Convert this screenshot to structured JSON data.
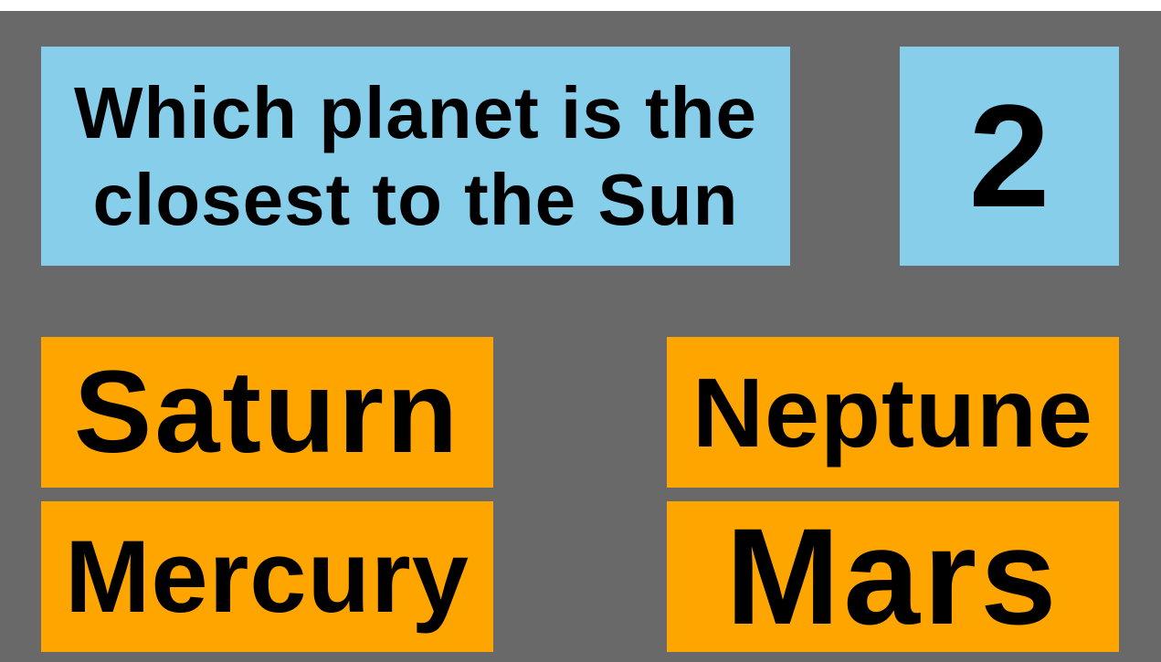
{
  "colors": {
    "background": "#696969",
    "question_box": "#87CEEB",
    "answer_box": "#FFA500",
    "text": "#000000"
  },
  "question": {
    "text": "Which planet is the closest to the Sun"
  },
  "counter": {
    "value": "2"
  },
  "answers": [
    {
      "label": "Saturn"
    },
    {
      "label": "Neptune"
    },
    {
      "label": "Mercury"
    },
    {
      "label": "Mars"
    }
  ]
}
